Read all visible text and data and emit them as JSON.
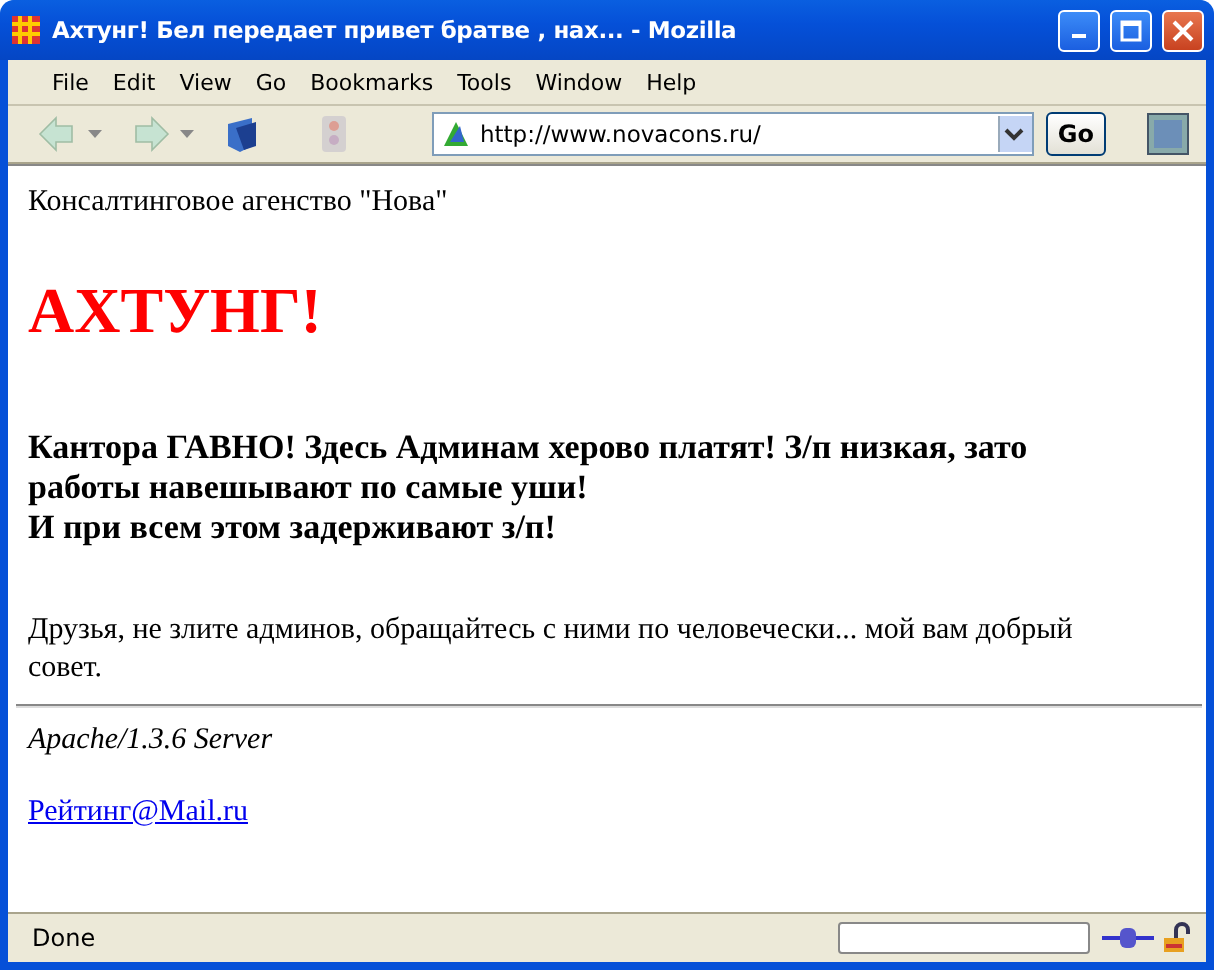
{
  "window": {
    "title": "Ахтунг! Бел передает привет братве , нах... - Mozilla"
  },
  "menu": [
    {
      "label": "File"
    },
    {
      "label": "Edit"
    },
    {
      "label": "View"
    },
    {
      "label": "Go"
    },
    {
      "label": "Bookmarks"
    },
    {
      "label": "Tools"
    },
    {
      "label": "Window"
    },
    {
      "label": "Help"
    }
  ],
  "toolbar": {
    "buttons": [
      {
        "kind": "back",
        "disabled": true
      },
      {
        "kind": "forward",
        "disabled": true
      },
      {
        "kind": "reload",
        "disabled": false
      },
      {
        "kind": "stop",
        "disabled": true
      }
    ],
    "url": "http://www.novacons.ru/",
    "go": "Go"
  },
  "page": {
    "company": "Консалтинговое агенство \"Нова\"",
    "heading": "АХТУНГ!",
    "complaint": [
      "Кантора ГАВНО! Здесь Админам херово платят! З/п низкая, зато работы навешывают по самые уши!",
      "И при всем этом задерживают з/п!"
    ],
    "advice": "Друзья, не злите админов, обращайтесь с ними по человечески... мой вам добрый совет.",
    "server": "Apache/1.3.6 Server",
    "link": "Рейтинг@Mail.ru"
  },
  "status_bar": {
    "text": "Done",
    "progress": {
      "level": 0
    }
  }
}
